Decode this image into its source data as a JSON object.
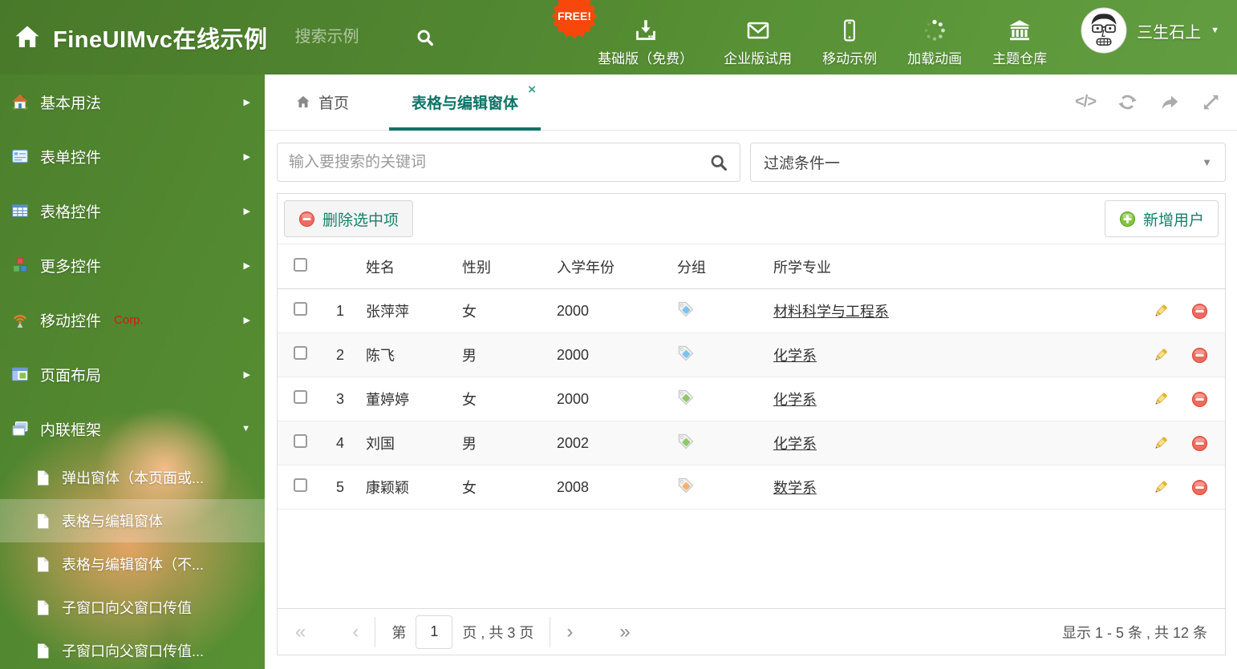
{
  "colors": {
    "accent": "#0e7466",
    "header_green": "#5c9638",
    "free_badge": "#f8470b",
    "delete_red": "#e2574b",
    "add_green": "#6fae3c",
    "link": "#333333"
  },
  "icons": {
    "close": "×",
    "caret_down": "▼",
    "chevron_right": "▶",
    "code": "</>",
    "first": "«",
    "prev": "‹",
    "next": "›",
    "last": "»"
  },
  "header": {
    "title": "FineUIMvc在线示例",
    "search_placeholder": "搜索示例",
    "free_badge": "FREE!",
    "nav": [
      {
        "label": "基础版（免费）",
        "icon": "download"
      },
      {
        "label": "企业版试用",
        "icon": "envelope"
      },
      {
        "label": "移动示例",
        "icon": "mobile"
      },
      {
        "label": "加载动画",
        "icon": "spinner"
      },
      {
        "label": "主题仓库",
        "icon": "bank"
      }
    ],
    "user": {
      "name": "三生石上"
    }
  },
  "sidebar": {
    "items": [
      {
        "label": "基本用法"
      },
      {
        "label": "表单控件"
      },
      {
        "label": "表格控件"
      },
      {
        "label": "更多控件"
      },
      {
        "label": "移动控件",
        "badge": "Corp."
      },
      {
        "label": "页面布局"
      },
      {
        "label": "内联框架"
      }
    ],
    "subitems": [
      {
        "label": "弹出窗体（本页面或..."
      },
      {
        "label": "表格与编辑窗体"
      },
      {
        "label": "表格与编辑窗体（不..."
      },
      {
        "label": "子窗口向父窗口传值"
      },
      {
        "label": "子窗口向父窗口传值..."
      }
    ]
  },
  "tabs": {
    "home_label": "首页",
    "active_label": "表格与编辑窗体"
  },
  "toolbar": {
    "search_placeholder": "输入要搜索的关键词",
    "filter_value": "过滤条件一",
    "delete_button": "删除选中项",
    "add_button": "新增用户"
  },
  "table": {
    "columns": [
      "姓名",
      "性别",
      "入学年份",
      "分组",
      "所学专业"
    ],
    "rows": [
      {
        "num": "1",
        "name": "张萍萍",
        "gender": "女",
        "year": "2000",
        "tag_color": "#7cc3f2",
        "major": "材料科学与工程系"
      },
      {
        "num": "2",
        "name": "陈飞",
        "gender": "男",
        "year": "2000",
        "tag_color": "#7cc3f2",
        "major": "化学系"
      },
      {
        "num": "3",
        "name": "董婷婷",
        "gender": "女",
        "year": "2000",
        "tag_color": "#8fc768",
        "major": "化学系"
      },
      {
        "num": "4",
        "name": "刘国",
        "gender": "男",
        "year": "2002",
        "tag_color": "#8fc768",
        "major": "化学系"
      },
      {
        "num": "5",
        "name": "康颖颖",
        "gender": "女",
        "year": "2008",
        "tag_color": "#f6b26b",
        "major": "数学系"
      }
    ]
  },
  "pagination": {
    "prefix": "第",
    "page": "1",
    "suffix": "页 , 共 3 页",
    "summary": "显示 1 - 5 条 , 共 12 条"
  }
}
